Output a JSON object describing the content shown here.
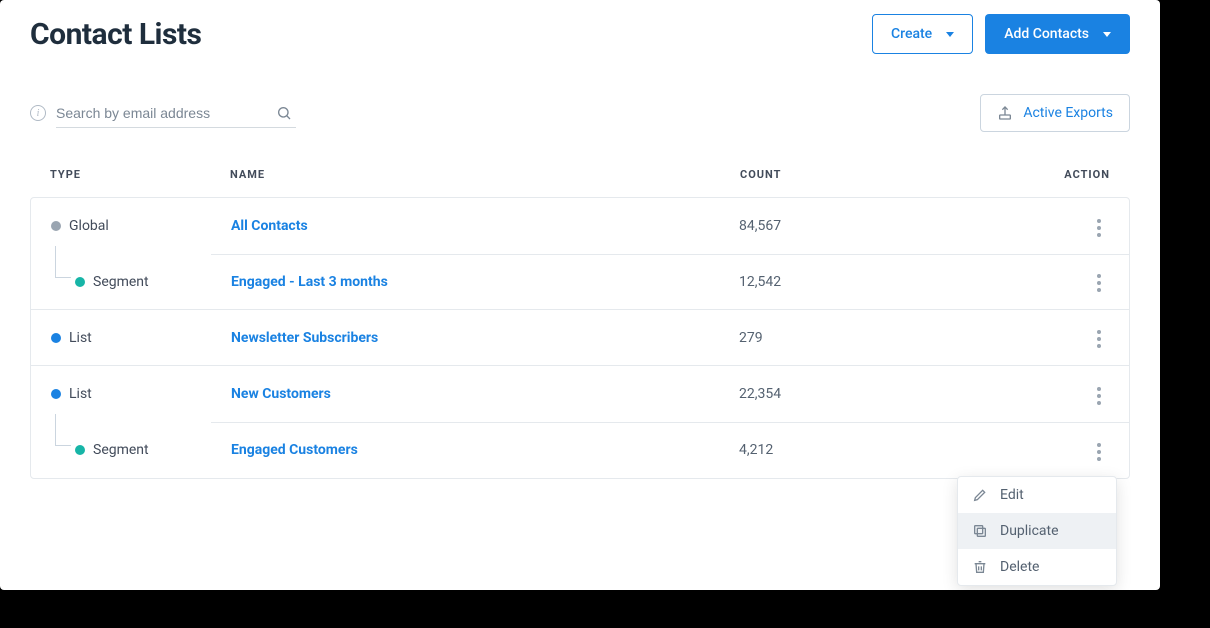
{
  "header": {
    "title": "Contact Lists",
    "create_label": "Create",
    "add_contacts_label": "Add Contacts"
  },
  "search": {
    "placeholder": "Search by email address",
    "active_exports_label": "Active Exports"
  },
  "table": {
    "headers": {
      "type": "TYPE",
      "name": "NAME",
      "count": "COUNT",
      "action": "ACTION"
    },
    "rows": [
      {
        "type_label": "Global",
        "name": "All Contacts",
        "count": "84,567"
      },
      {
        "type_label": "Segment",
        "name": "Engaged - Last 3 months",
        "count": "12,542"
      },
      {
        "type_label": "List",
        "name": "Newsletter Subscribers",
        "count": "279"
      },
      {
        "type_label": "List",
        "name": "New Customers",
        "count": "22,354"
      },
      {
        "type_label": "Segment",
        "name": "Engaged Customers",
        "count": "4,212"
      }
    ]
  },
  "dropdown": {
    "edit": "Edit",
    "duplicate": "Duplicate",
    "delete": "Delete"
  }
}
